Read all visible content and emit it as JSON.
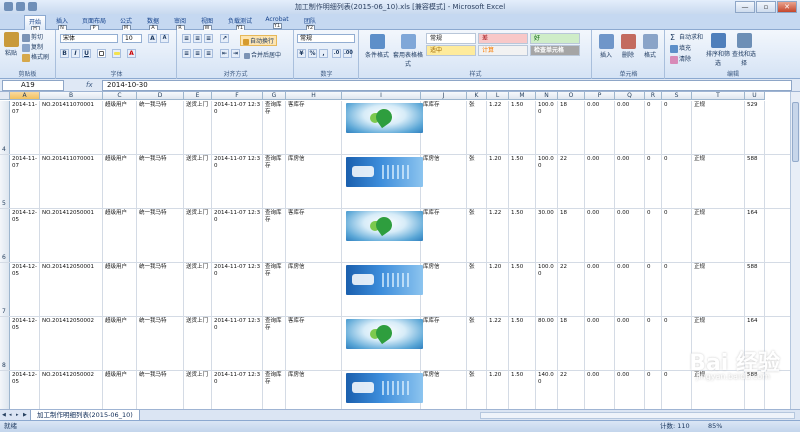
{
  "window": {
    "title": "加工制作明细列表(2015-06_10).xls [兼容模式] - Microsoft Excel",
    "buttons": [
      "—",
      "▫",
      "✕"
    ]
  },
  "tabs": [
    {
      "label": "开始",
      "key": "H"
    },
    {
      "label": "插入",
      "key": "N"
    },
    {
      "label": "页面布局",
      "key": "P"
    },
    {
      "label": "公式",
      "key": "M"
    },
    {
      "label": "数据",
      "key": "A"
    },
    {
      "label": "审阅",
      "key": "R"
    },
    {
      "label": "视图",
      "key": "W"
    },
    {
      "label": "负载测试",
      "key": "Y1"
    },
    {
      "label": "Acrobat",
      "key": "Y1"
    },
    {
      "label": "团队",
      "key": "Y2"
    }
  ],
  "ribbon": {
    "clipboard": {
      "paste": "粘贴",
      "cut": "剪切",
      "copy": "复制",
      "format_painter": "格式刷",
      "label": "剪贴板"
    },
    "font": {
      "name": "宋体",
      "size": "10",
      "bold": "B",
      "italic": "I",
      "underline": "U",
      "grow": "A",
      "shrink": "A",
      "label": "字体"
    },
    "alignment": {
      "wrap": "自动换行",
      "merge": "合并后居中",
      "label": "对齐方式"
    },
    "number": {
      "format": "常规",
      "label": "数字"
    },
    "styles": {
      "cond_format": "条件格式",
      "table_format": "套用表格格式",
      "normal": "常规",
      "bad": "差",
      "good": "好",
      "neutral": "适中",
      "calc": "计算",
      "check_cell": "检查单元格",
      "label": "样式"
    },
    "cells": {
      "insert": "插入",
      "delete": "删除",
      "format": "格式",
      "label": "单元格"
    },
    "editing": {
      "autosum": "自动求和",
      "fill": "填充",
      "clear": "清除",
      "sort": "排序和筛选",
      "find": "查找和选择",
      "label": "编辑"
    }
  },
  "formula_bar": {
    "cell": "A19",
    "fx": "fx",
    "value": "2014-10-30"
  },
  "columns": [
    "A",
    "B",
    "C",
    "D",
    "E",
    "F",
    "G",
    "H",
    "I",
    "J",
    "K",
    "L",
    "M",
    "N",
    "O",
    "P",
    "Q",
    "R",
    "S",
    "T",
    "U"
  ],
  "selected_column": "A",
  "rows": [
    {
      "num": "4",
      "cells": [
        "2014-11-07",
        "NO.201411070001",
        "超级用户",
        "统一我马特",
        "送货上门",
        "2014-11-07 12:30",
        "查询库存",
        "客库存",
        "",
        "库库存",
        "张",
        "1.22",
        "1.50",
        "100.00",
        "18",
        "0.00",
        "0.00",
        "0",
        "0",
        "正规",
        "529"
      ],
      "pic": "a"
    },
    {
      "num": "5",
      "cells": [
        "2014-11-07",
        "NO.201411070001",
        "超级用户",
        "统一我马特",
        "送货上门",
        "2014-11-07 12:30",
        "查询库存",
        "库房信",
        "",
        "库房信",
        "张",
        "1.20",
        "1.50",
        "100.00",
        "22",
        "0.00",
        "0.00",
        "0",
        "0",
        "正规",
        "588"
      ],
      "pic": "b"
    },
    {
      "num": "6",
      "cells": [
        "2014-12-05",
        "NO.201412050001",
        "超级用户",
        "统一我马特",
        "送货上门",
        "2014-11-07 12:30",
        "查询库存",
        "客库存",
        "",
        "库库存",
        "张",
        "1.22",
        "1.50",
        "30.00",
        "18",
        "0.00",
        "0.00",
        "0",
        "0",
        "正规",
        "164"
      ],
      "pic": "a"
    },
    {
      "num": "7",
      "cells": [
        "2014-12-05",
        "NO.201412050001",
        "超级用户",
        "统一我马特",
        "送货上门",
        "2014-11-07 12:30",
        "查询库存",
        "库房信",
        "",
        "库房信",
        "张",
        "1.20",
        "1.50",
        "100.00",
        "22",
        "0.00",
        "0.00",
        "0",
        "0",
        "正规",
        "588"
      ],
      "pic": "b"
    },
    {
      "num": "8",
      "cells": [
        "2014-12-05",
        "NO.201412050002",
        "超级用户",
        "统一我马特",
        "送货上门",
        "2014-11-07 12:30",
        "查询库存",
        "客库存",
        "",
        "库库存",
        "张",
        "1.22",
        "1.50",
        "80.00",
        "18",
        "0.00",
        "0.00",
        "0",
        "0",
        "正规",
        "164"
      ],
      "pic": "a"
    },
    {
      "num": "9",
      "cells": [
        "2014-12-05",
        "NO.201412050002",
        "超级用户",
        "统一我马特",
        "送货上门",
        "2014-11-07 12:30",
        "查询库存",
        "库房信",
        "",
        "库房信",
        "张",
        "1.20",
        "1.50",
        "140.00",
        "22",
        "0.00",
        "0.00",
        "0",
        "0",
        "正规",
        "588"
      ],
      "pic": "b"
    }
  ],
  "sheet_tab": "加工制作明细列表(2015-06_10)",
  "status": {
    "ready": "就绪",
    "count": "计数: 110",
    "zoom": "85%"
  },
  "watermark": {
    "brand": "Bai 经验",
    "url": "jingyan.baidu.com"
  }
}
